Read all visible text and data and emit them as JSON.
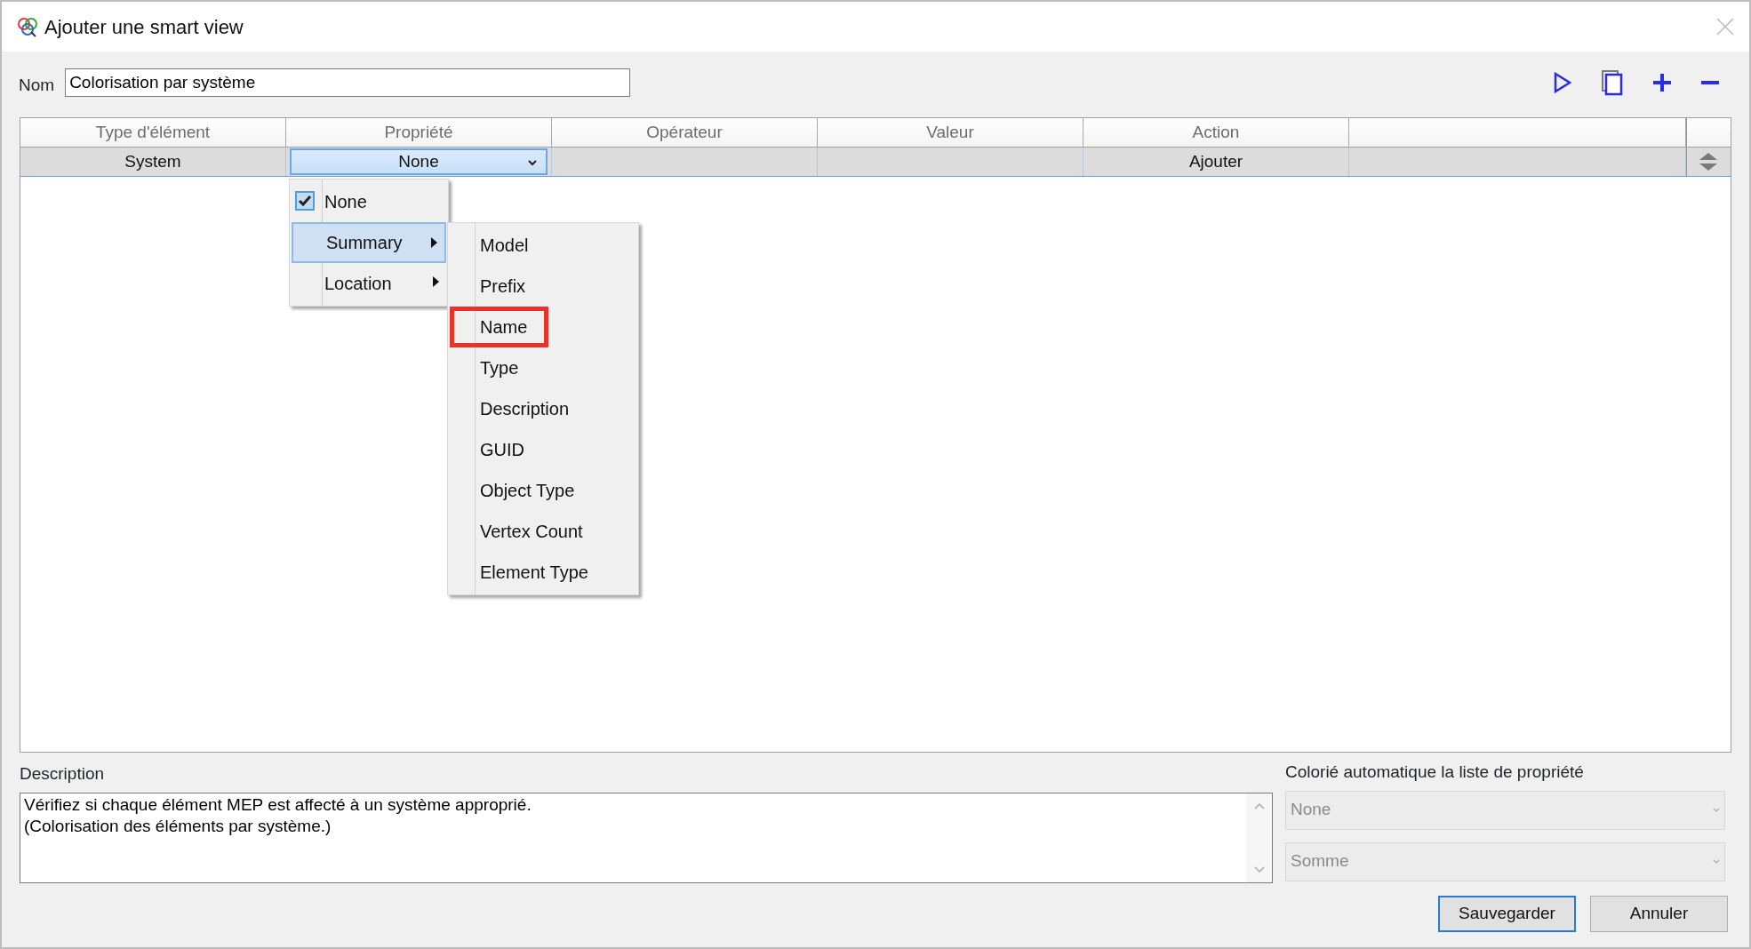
{
  "window": {
    "title": "Ajouter une smart view"
  },
  "name_field": {
    "label": "Nom",
    "value": "Colorisation par système"
  },
  "table": {
    "columns": [
      "Type d'élément",
      "Propriété",
      "Opérateur",
      "Valeur",
      "Action"
    ],
    "rows": [
      {
        "element_type": "System",
        "property": "None",
        "action": "Ajouter"
      }
    ]
  },
  "property_menu": {
    "items": [
      {
        "label": "None",
        "checked": true,
        "highlighted": false,
        "has_submenu": false
      },
      {
        "label": "Summary",
        "checked": false,
        "highlighted": true,
        "has_submenu": true
      },
      {
        "label": "Location",
        "checked": false,
        "highlighted": false,
        "has_submenu": true
      }
    ]
  },
  "submenu": {
    "items": [
      {
        "label": "Model",
        "outlined": false
      },
      {
        "label": "Prefix",
        "outlined": false
      },
      {
        "label": "Name",
        "outlined": true
      },
      {
        "label": "Type",
        "outlined": false
      },
      {
        "label": "Description",
        "outlined": false
      },
      {
        "label": "GUID",
        "outlined": false
      },
      {
        "label": "Object Type",
        "outlined": false
      },
      {
        "label": "Vertex Count",
        "outlined": false
      },
      {
        "label": "Element Type",
        "outlined": false
      }
    ]
  },
  "description": {
    "label": "Description",
    "value": "Vérifiez si chaque élément MEP est affecté à un système approprié.\n(Colorisation des éléments par système.)"
  },
  "auto_color": {
    "label": "Colorié automatique la liste de propriété",
    "selects": [
      {
        "value": "None",
        "disabled": true
      },
      {
        "value": "Somme",
        "disabled": true
      }
    ]
  },
  "buttons": [
    {
      "label": "Sauvegarder",
      "default": true
    },
    {
      "label": "Annuler",
      "default": false
    }
  ]
}
